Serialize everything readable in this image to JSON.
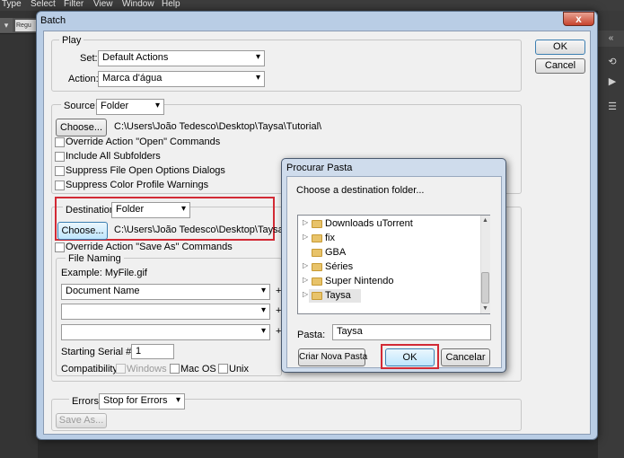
{
  "menubar": [
    "Type",
    "Select",
    "Filter",
    "View",
    "Window",
    "Help"
  ],
  "ps": {
    "option_field": "Regu",
    "right_collapse": "«"
  },
  "window": {
    "title": "Batch",
    "close": "x"
  },
  "buttons": {
    "ok": "OK",
    "cancel": "Cancel"
  },
  "play": {
    "legend": "Play",
    "set_label": "Set:",
    "set_value": "Default Actions",
    "action_label": "Action:",
    "action_value": "Marca d'água"
  },
  "source": {
    "label": "Source:",
    "value": "Folder",
    "choose": "Choose...",
    "path": "C:\\Users\\João Tedesco\\Desktop\\Taysa\\Tutorial\\",
    "options": [
      "Override Action \"Open\" Commands",
      "Include All Subfolders",
      "Suppress File Open Options Dialogs",
      "Suppress Color Profile Warnings"
    ]
  },
  "destination": {
    "label": "Destination:",
    "value": "Folder",
    "choose": "Choose...",
    "path": "C:\\Users\\João Tedesco\\Desktop\\Taysa\\",
    "override": "Override Action \"Save As\" Commands"
  },
  "file_naming": {
    "legend": "File Naming",
    "example": "Example: MyFile.gif",
    "field1": "Document Name",
    "plus": "+",
    "serial_label": "Starting Serial #:",
    "serial_value": "1",
    "compat_label": "Compatibility:",
    "compat": [
      "Windows",
      "Mac OS",
      "Unix"
    ]
  },
  "errors": {
    "label": "Errors:",
    "value": "Stop for Errors",
    "save_as": "Save As..."
  },
  "browse": {
    "title": "Procurar Pasta",
    "prompt": "Choose a destination folder...",
    "folders": [
      "Downloads uTorrent",
      "fix",
      "GBA",
      "Séries",
      "Super Nintendo",
      "Taysa"
    ],
    "pasta_label": "Pasta:",
    "pasta_value": "Taysa",
    "new_folder": "Criar Nova Pasta",
    "ok": "OK",
    "cancel": "Cancelar"
  },
  "colors": {
    "highlight": "#d22a35",
    "title_bar": "#b9cde5"
  }
}
